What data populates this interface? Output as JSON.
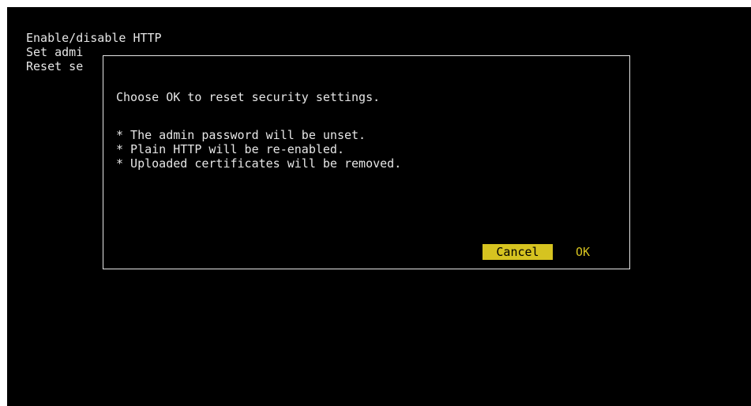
{
  "menu": {
    "items": [
      "Enable/disable HTTP",
      "Set admi",
      "Reset se"
    ]
  },
  "dialog": {
    "message": "Choose OK to reset security settings.",
    "bullets": [
      "* The admin password will be unset.",
      "* Plain HTTP will be re-enabled.",
      "* Uploaded certificates will be removed."
    ],
    "cancel_label": "Cancel",
    "ok_label": "OK"
  },
  "colors": {
    "background": "#000000",
    "text": "#e6e6e6",
    "accent": "#d6c320"
  }
}
